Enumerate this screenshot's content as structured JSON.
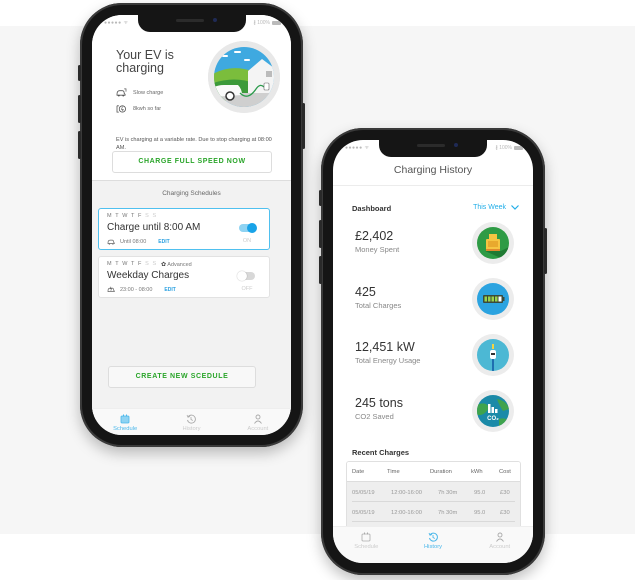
{
  "status_bar": {
    "signal": "●●●●● ᯤ",
    "battery": "∦ 100%"
  },
  "schedule_screen": {
    "hero": {
      "title": "Your EV is charging",
      "charge_mode": "Slow charge",
      "energy_so_far": "8kwh so far",
      "description": "EV is charging at a variable rate. Due to stop charging at 08:00 AM."
    },
    "charge_full_speed_label": "CHARGE FULL SPEED NOW",
    "schedules_heading": "Charging Schedules",
    "schedules": [
      {
        "days_active": "M T W T F",
        "days_inactive": "S S",
        "advanced_label": "",
        "title": "Charge until 8:00 AM",
        "detail": "Until 08:00",
        "edit_label": "EDIT",
        "enabled": true,
        "toggle_label": "ON"
      },
      {
        "days_active": "M T W T F",
        "days_inactive": "S S",
        "advanced_label": "Advanced",
        "title": "Weekday Charges",
        "detail": "23:00 - 08:00",
        "edit_label": "EDIT",
        "enabled": false,
        "toggle_label": "OFF"
      }
    ],
    "create_schedule_label": "CREATE NEW SCEDULE",
    "tabs": [
      {
        "label": "Schedule",
        "icon": "calendar-icon",
        "active": true
      },
      {
        "label": "History",
        "icon": "history-icon",
        "active": false
      },
      {
        "label": "Account",
        "icon": "user-icon",
        "active": false
      }
    ]
  },
  "history_screen": {
    "title": "Charging History",
    "dashboard_label": "Dashboard",
    "period_selector": "This Week",
    "stats": [
      {
        "value": "£2,402",
        "label": "Money Spent",
        "icon": "cash-register-icon",
        "color": "#2e9b45"
      },
      {
        "value": "425",
        "label": "Total Charges",
        "icon": "battery-icon",
        "color": "#2ba3e0"
      },
      {
        "value": "12,451 kW",
        "label": "Total Energy Usage",
        "icon": "charging-plug-icon",
        "color": "#4cb8d4"
      },
      {
        "value": "245 tons",
        "label": "CO2 Saved",
        "icon": "co2-globe-icon",
        "color": "#1b8aa8"
      }
    ],
    "recent_label": "Recent Charges",
    "table": {
      "columns": [
        "Date",
        "Time",
        "Duration",
        "kWh",
        "Cost"
      ],
      "rows": [
        [
          "05/05/19",
          "12:00-16:00",
          "7h 30m",
          "95.0",
          "£30"
        ],
        [
          "05/05/19",
          "12:00-16:00",
          "7h 30m",
          "95.0",
          "£30"
        ]
      ]
    },
    "tabs": [
      {
        "label": "Schedule",
        "icon": "calendar-icon",
        "active": false
      },
      {
        "label": "History",
        "icon": "history-icon",
        "active": true
      },
      {
        "label": "Account",
        "icon": "user-icon",
        "active": false
      }
    ]
  },
  "colors": {
    "accent_blue": "#22aee8",
    "action_green": "#2aa52a"
  }
}
